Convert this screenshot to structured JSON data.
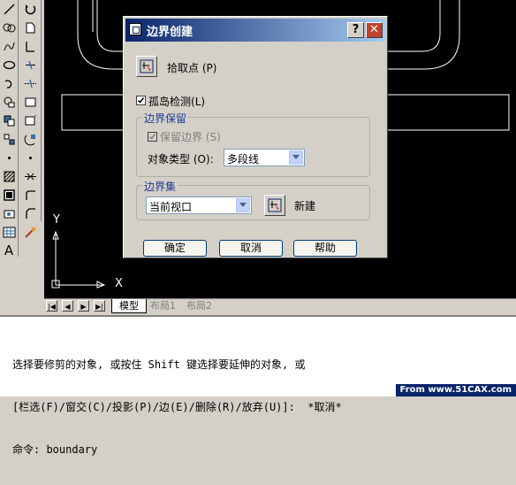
{
  "left_toolbar": {
    "col1": [
      "line-icon",
      "polyline-icon",
      "arc-icon",
      "ellipse-icon",
      "revcloud-icon",
      "rectangle-icon",
      "hatch-icon",
      "circle-icon",
      "point-icon",
      "explode-icon",
      "region-icon",
      "table-icon",
      "multiline-text-icon"
    ],
    "col2": [
      "undo-icon",
      "copy-icon",
      "mirror-icon",
      "offset-icon",
      "array-icon",
      "move-icon",
      "rotate-icon",
      "scale-icon",
      "stretch-icon",
      "trim-icon",
      "extend-icon",
      "break-icon",
      "fillet-icon"
    ],
    "text_tool_glyph": "A"
  },
  "canvas": {
    "background": "#000000",
    "ucs_x_label": "X",
    "ucs_y_label": "Y"
  },
  "layout_tabs": {
    "nav": [
      "|◀",
      "◀",
      "▶",
      "▶|"
    ],
    "tabs": [
      "模型",
      "布局1",
      "布局2"
    ]
  },
  "dialog": {
    "title": "边界创建",
    "help_glyph": "?",
    "close_glyph": "✕",
    "pick_points_label": "拾取点",
    "pick_points_hotkey": "(P)",
    "island_detection_label": "孤岛检测",
    "island_detection_hotkey": "(L)",
    "island_detection_checked": true,
    "boundary_retention": {
      "title": "边界保留",
      "retain_label": "保留边界",
      "retain_hotkey": "(S)",
      "retain_checked": true,
      "retain_disabled": true,
      "object_type_label": "对象类型",
      "object_type_hotkey": "(O):",
      "object_type_value": "多段线"
    },
    "boundary_set": {
      "title": "边界集",
      "value": "当前视口",
      "new_label": "新建"
    },
    "buttons": {
      "ok": "确定",
      "cancel": "取消",
      "help": "帮助"
    }
  },
  "command": {
    "lines": [
      "选择要修剪的对象, 或按住 Shift 键选择要延伸的对象, 或",
      "[栏选(F)/窗交(C)/投影(P)/边(E)/删除(R)/放弃(U)]:  *取消*",
      "命令: boundary"
    ],
    "watermark": "From www.51CAX.com"
  },
  "colors": {
    "title_gradient_start": "#0a246a",
    "title_gradient_end": "#a6caf0",
    "group_title": "#1c3a94",
    "close_button": "#c1432d"
  }
}
